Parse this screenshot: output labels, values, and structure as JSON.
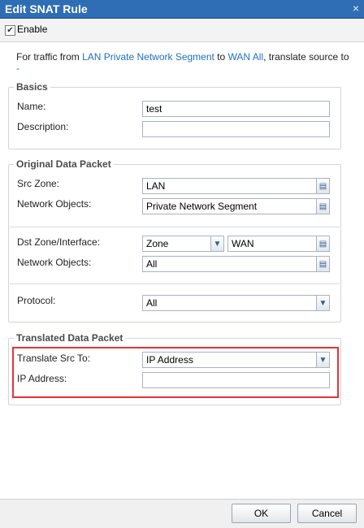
{
  "window": {
    "title": "Edit SNAT Rule",
    "close_glyph": "×"
  },
  "enable": {
    "label": "Enable",
    "checked": true
  },
  "info": {
    "prefix": "For traffic from ",
    "src_link": "LAN Private Network Segment",
    "middle": " to ",
    "dst_link": "WAN All",
    "suffix": ", translate source to ",
    "tail_link": "-"
  },
  "basics": {
    "legend": "Basics",
    "name_label": "Name:",
    "name_value": "test",
    "description_label": "Description:",
    "description_value": ""
  },
  "original": {
    "legend": "Original Data Packet",
    "src_zone_label": "Src Zone:",
    "src_zone_value": "LAN",
    "src_objects_label": "Network Objects:",
    "src_objects_value": "Private Network Segment",
    "dst_label": "Dst Zone/Interface:",
    "dst_type_value": "Zone",
    "dst_zone_value": "WAN",
    "dst_objects_label": "Network Objects:",
    "dst_objects_value": "All",
    "protocol_label": "Protocol:",
    "protocol_value": "All"
  },
  "translated": {
    "legend": "Translated Data Packet",
    "translate_label": "Translate Src To:",
    "translate_value": "IP Address",
    "ip_label": "IP Address:",
    "ip_value": ""
  },
  "footer": {
    "ok_label": "OK",
    "cancel_label": "Cancel"
  },
  "colors": {
    "title_bar": "#2f6db5",
    "link": "#1f6fc0",
    "highlight": "#e0343a"
  }
}
